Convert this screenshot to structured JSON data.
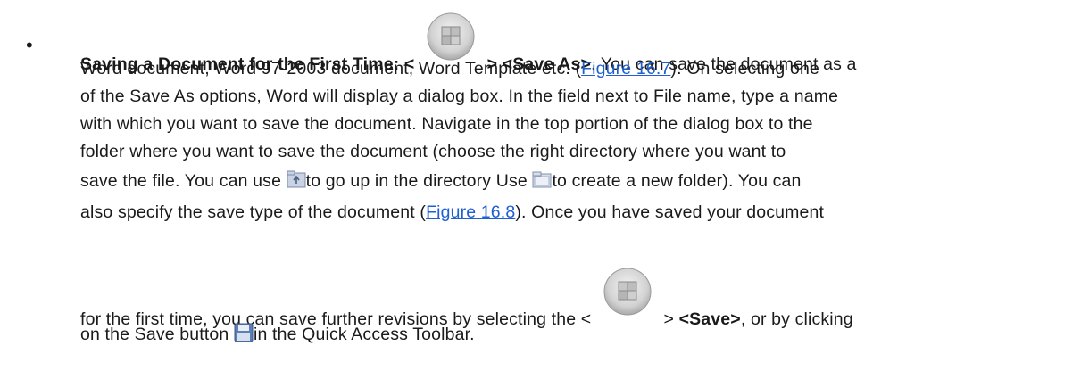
{
  "bullet": "•",
  "para": {
    "title": "Saving a Document for the First Time:",
    "l1_open": "<",
    "l1_close": "> <Save As>",
    "l1_rest": ". You can save the document as a",
    "l2": "Word document, Word 97-2003 document, Word Template etc. (",
    "link1": "Figure 16.7",
    "l2_end": "). On selecting one",
    "l3": "of the Save As options, Word will display a dialog box. In the field next to File name, type a name",
    "l4": "with which you want to save the document. Navigate in the top portion of the dialog box to the",
    "l5": "folder where you want to save the document (choose the right directory where you want to",
    "l6a": "save the file. You can use",
    "l6b": "to go up in the directory Use",
    "l6c": "to create a new folder). You can",
    "l7": "also specify the save type of the document (",
    "link2": "Figure 16.8",
    "l7_end": "). Once you have saved your document",
    "l8a": "for the first time, you can save further revisions by selecting the <",
    "l8b": ">",
    "l8c": "<Save>",
    "l8d": ", or by clicking",
    "l9a": "on the Save button",
    "l9b": "in the Quick Access Toolbar."
  },
  "icons": {
    "office_button": "office-button-icon",
    "up_folder": "up-one-level-icon",
    "new_folder": "new-folder-icon",
    "save": "save-icon"
  },
  "colors": {
    "link": "#1f5fd0"
  }
}
